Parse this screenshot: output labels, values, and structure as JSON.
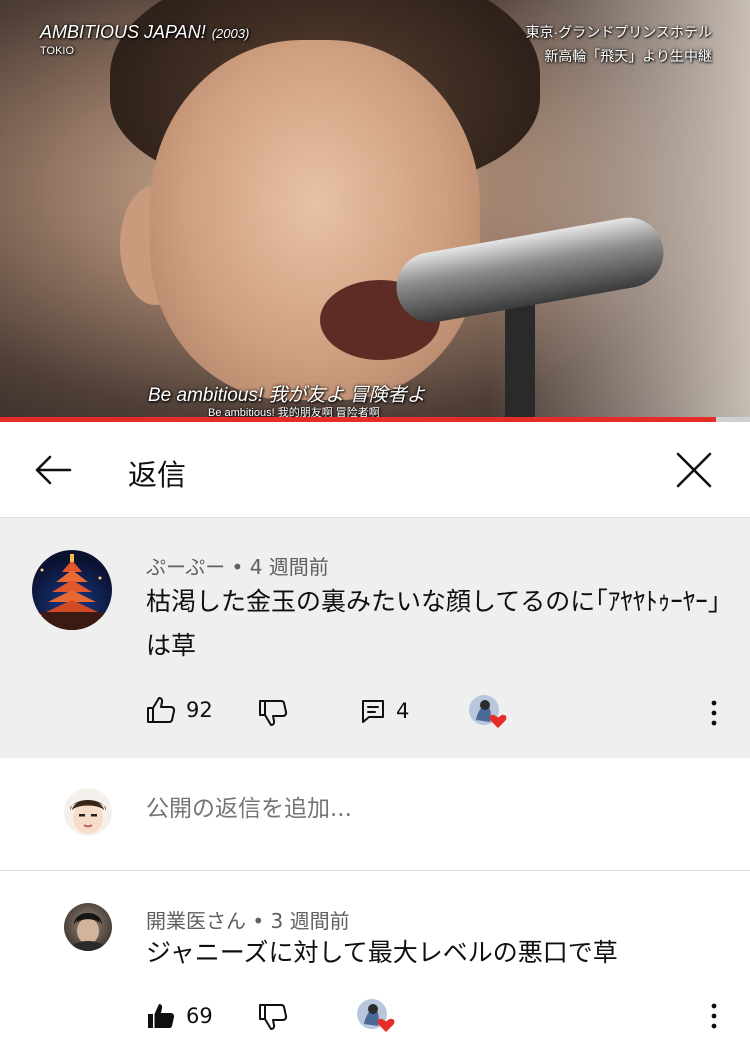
{
  "video": {
    "song_title": "AMBITIOUS JAPAN!",
    "year": "(2003)",
    "artist": "TOKIO",
    "location_line1": "東京·グランドプリンスホテル",
    "location_line2": "新高輪「飛天」より生中継",
    "lyric_main": "Be ambitious! 我が友よ 冒険者よ",
    "lyric_sub": "Be ambitious! 我的朋友啊 冒险者啊",
    "progress_fraction": 0.955,
    "progress_color": "#e52d27"
  },
  "header": {
    "title": "返信",
    "back_icon": "arrow-left-icon",
    "close_icon": "close-icon"
  },
  "comments": [
    {
      "author_meta": "ぷーぷー • 4 週間前",
      "text": "枯渇した金玉の裏みたいな顔してるのに｢ｱﾔﾔﾄｩｰﾔｰ｣ は草",
      "likes": "92",
      "replies": "4",
      "creator_hearted": true
    },
    {
      "author_meta": "開業医さん • 3 週間前",
      "text": "ジャニーズに対して最大レベルの悪口で草",
      "likes": "69",
      "creator_hearted": true
    }
  ],
  "reply_box": {
    "placeholder": "公開の返信を追加..."
  },
  "colors": {
    "highlight_bg": "#efefef",
    "heart": "#e52d27",
    "meta_text": "#606060"
  }
}
